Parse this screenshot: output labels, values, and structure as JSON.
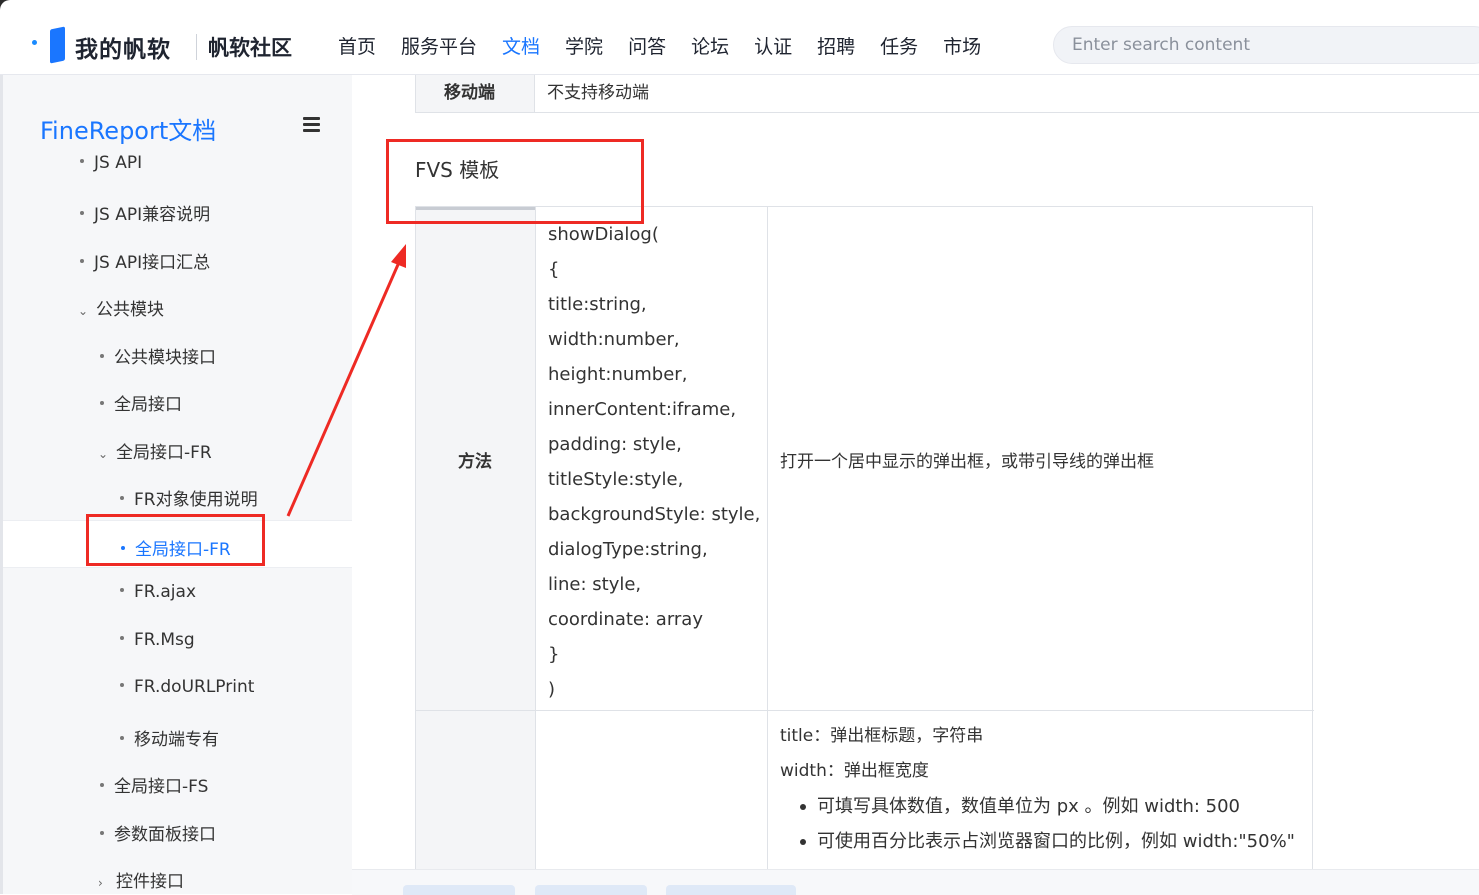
{
  "header": {
    "logo_main": "我的帆软",
    "logo_sub": "帆软社区",
    "nav": [
      {
        "label": "首页",
        "active": false
      },
      {
        "label": "服务平台",
        "active": false
      },
      {
        "label": "文档",
        "active": true
      },
      {
        "label": "学院",
        "active": false
      },
      {
        "label": "问答",
        "active": false
      },
      {
        "label": "论坛",
        "active": false
      },
      {
        "label": "认证",
        "active": false
      },
      {
        "label": "招聘",
        "active": false
      },
      {
        "label": "任务",
        "active": false
      },
      {
        "label": "市场",
        "active": false
      }
    ],
    "search_placeholder": "Enter search content"
  },
  "sidebar": {
    "title": "FineReport文档",
    "items": [
      {
        "label": "JS API"
      },
      {
        "label": "JS API兼容说明"
      },
      {
        "label": "JS API接口汇总"
      },
      {
        "label": "公共模块",
        "chevron": "⌄"
      },
      {
        "label": "公共模块接口"
      },
      {
        "label": "全局接口"
      },
      {
        "label": "全局接口-FR",
        "chevron": "⌄"
      },
      {
        "label": "FR对象使用说明"
      },
      {
        "label": "全局接口-FR",
        "active": true
      },
      {
        "label": "FR.ajax"
      },
      {
        "label": "FR.Msg"
      },
      {
        "label": "FR.doURLPrint"
      },
      {
        "label": "移动端专有"
      },
      {
        "label": "全局接口-FS"
      },
      {
        "label": "参数面板接口"
      },
      {
        "label": "控件接口",
        "chevron": "›"
      }
    ]
  },
  "content": {
    "top_row": {
      "header": "移动端",
      "value": "不支持移动端"
    },
    "section_title": "FVS 模板",
    "method_header": "方法",
    "code_lines": [
      "showDialog(",
      "{",
      "title:string,",
      "width:number,",
      "height:number,",
      "innerContent:iframe,",
      "padding: style,",
      "titleStyle:style,",
      "backgroundStyle: style,",
      "dialogType:string,",
      "line: style,",
      "coordinate: array",
      "}",
      ")"
    ],
    "method_desc": "打开一个居中显示的弹出框，或带引导线的弹出框",
    "params": {
      "title": "title：弹出框标题，字符串",
      "width": "width：弹出框宽度",
      "bullets": [
        "可填写具体数值，数值单位为 px 。例如 width: 500",
        "可使用百分比表示占浏览器窗口的比例，例如 width:\"50%\""
      ]
    }
  },
  "colors": {
    "accent": "#1a76ff",
    "annotation_red": "#ee2a24"
  }
}
